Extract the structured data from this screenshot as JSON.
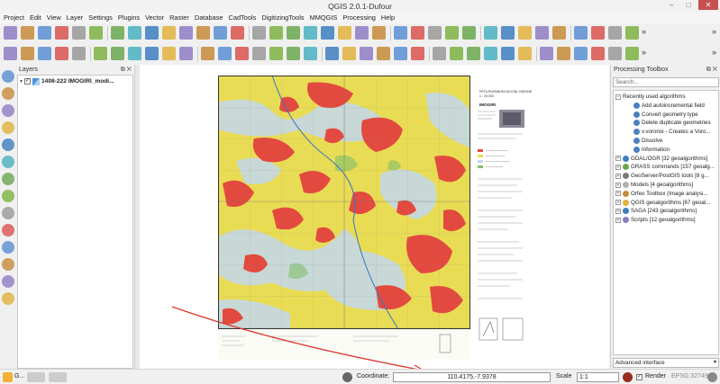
{
  "window": {
    "title": "QGIS 2.0.1-Dufour"
  },
  "menubar": [
    "Project",
    "Edit",
    "View",
    "Layer",
    "Settings",
    "Plugins",
    "Vector",
    "Raster",
    "Database",
    "CadTools",
    "DigitizingTools",
    "MMQGIS",
    "Processing",
    "Help"
  ],
  "toolbar_more": "»",
  "layers_panel": {
    "title": "Layers",
    "layer": {
      "name": "1408-222 IMOGIRI_modi...",
      "checked": true
    }
  },
  "processing": {
    "title": "Processing Toolbox",
    "search_placeholder": "Search...",
    "recent_group": "Recently used algorithms",
    "recent": [
      "Add autoincremental field",
      "Convert geometry type",
      "Delete duplicate geometries",
      "v.voronoi - Creates a Voro...",
      "Dissolve",
      "Information"
    ],
    "providers": [
      "GDAL/OGR [32 geoalgorithms]",
      "GRASS commands [157 geoalg...",
      "GeoServer/PostGIS tools [8 g...",
      "Models [4 geoalgorithms]",
      "Orfeo Toolbox (Image analysi...",
      "QGIS geoalgorithms [67 geoal...",
      "SAGA [243 geoalgorithms]",
      "Scripts [12 geoalgorithms]"
    ],
    "interface_mode": "Advanced interface"
  },
  "map_sheet": {
    "header": "PETA RUPABUMI DIGITAL INDONESIA 1 : 25.000",
    "sheet_name": "IMOGIRI"
  },
  "statusbar": {
    "coordinate_label": "Coordinate:",
    "coordinate": "110.4175,-7.9378",
    "scale_label": "Scale",
    "scale": "1:1",
    "render_label": "Render",
    "render_checked": true,
    "crs": "EPSG:32749",
    "left_text": "G..."
  },
  "colors": {
    "landuse_yellow": "#e9dc55",
    "landuse_red": "#e34a3f",
    "landuse_blue": "#c4d8e6",
    "annotation_arrow": "#d9362c"
  }
}
